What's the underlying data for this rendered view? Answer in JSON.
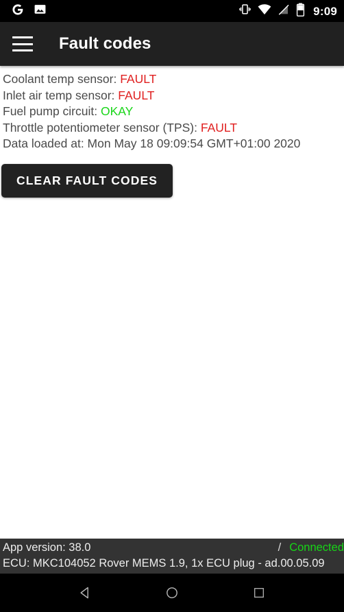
{
  "status_bar": {
    "icons_left": [
      "google-icon",
      "photo-notification-icon"
    ],
    "icons_right": [
      "vibrate-icon",
      "wifi-icon",
      "signal-off-icon",
      "battery-icon"
    ],
    "time": "9:09"
  },
  "app_bar": {
    "menu_icon": "hamburger-menu-icon",
    "title": "Fault codes"
  },
  "fault_list": [
    {
      "label": "Coolant temp sensor:",
      "value": "FAULT",
      "state": "fault"
    },
    {
      "label": "Inlet air temp sensor:",
      "value": "FAULT",
      "state": "fault"
    },
    {
      "label": "Fuel pump circuit:",
      "value": "OKAY",
      "state": "okay"
    },
    {
      "label": "Throttle potentiometer sensor (TPS):",
      "value": "FAULT",
      "state": "fault"
    }
  ],
  "data_loaded": "Data loaded at: Mon May 18 09:09:54 GMT+01:00 2020",
  "actions": {
    "clear_fault_codes": "CLEAR FAULT CODES"
  },
  "info_bar": {
    "app_version": "App version: 38.0",
    "separator": "/",
    "connection_status": "Connected",
    "ecu": "ECU: MKC104052 Rover MEMS 1.9, 1x ECU plug - ad.00.05.09"
  },
  "nav_bar": {
    "back": "back-icon",
    "home": "home-icon",
    "recents": "recents-icon"
  },
  "colors": {
    "fault": "#e02020",
    "okay": "#17d517",
    "connected": "#17d517",
    "app_bar_bg": "#212121",
    "info_bar_bg": "#333333",
    "button_bg": "#222222"
  }
}
